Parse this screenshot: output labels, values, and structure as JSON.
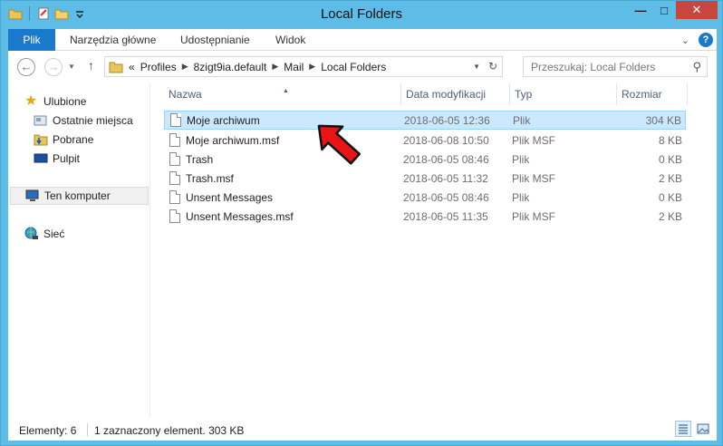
{
  "window": {
    "title": "Local Folders"
  },
  "ribbon": {
    "tabs": [
      "Plik",
      "Narzędzia główne",
      "Udostępnianie",
      "Widok"
    ],
    "help": "?"
  },
  "address": {
    "prefix": "«",
    "crumbs": [
      "Profiles",
      "8zigt9ia.default",
      "Mail",
      "Local Folders"
    ]
  },
  "search": {
    "placeholder": "Przeszukaj: Local Folders"
  },
  "nav": {
    "favorites": "Ulubione",
    "recent": "Ostatnie miejsca",
    "downloads": "Pobrane",
    "desktop": "Pulpit",
    "computer": "Ten komputer",
    "network": "Sieć"
  },
  "columns": {
    "name": "Nazwa",
    "date": "Data modyfikacji",
    "type": "Typ",
    "size": "Rozmiar"
  },
  "files": [
    {
      "name": "Moje archiwum",
      "date": "2018-06-05 12:36",
      "type": "Plik",
      "size": "304 KB"
    },
    {
      "name": "Moje archiwum.msf",
      "date": "2018-06-08 10:50",
      "type": "Plik MSF",
      "size": "8 KB"
    },
    {
      "name": "Trash",
      "date": "2018-06-05 08:46",
      "type": "Plik",
      "size": "0 KB"
    },
    {
      "name": "Trash.msf",
      "date": "2018-06-05 11:32",
      "type": "Plik MSF",
      "size": "2 KB"
    },
    {
      "name": "Unsent Messages",
      "date": "2018-06-05 08:46",
      "type": "Plik",
      "size": "0 KB"
    },
    {
      "name": "Unsent Messages.msf",
      "date": "2018-06-05 11:35",
      "type": "Plik MSF",
      "size": "2 KB"
    }
  ],
  "status": {
    "count": "Elementy: 6",
    "selection": "1 zaznaczony element. 303 KB"
  },
  "colors": {
    "accent": "#1979ca",
    "selection": "#cce8ff",
    "frame": "#5dbde6",
    "arrow": "#e81416"
  }
}
